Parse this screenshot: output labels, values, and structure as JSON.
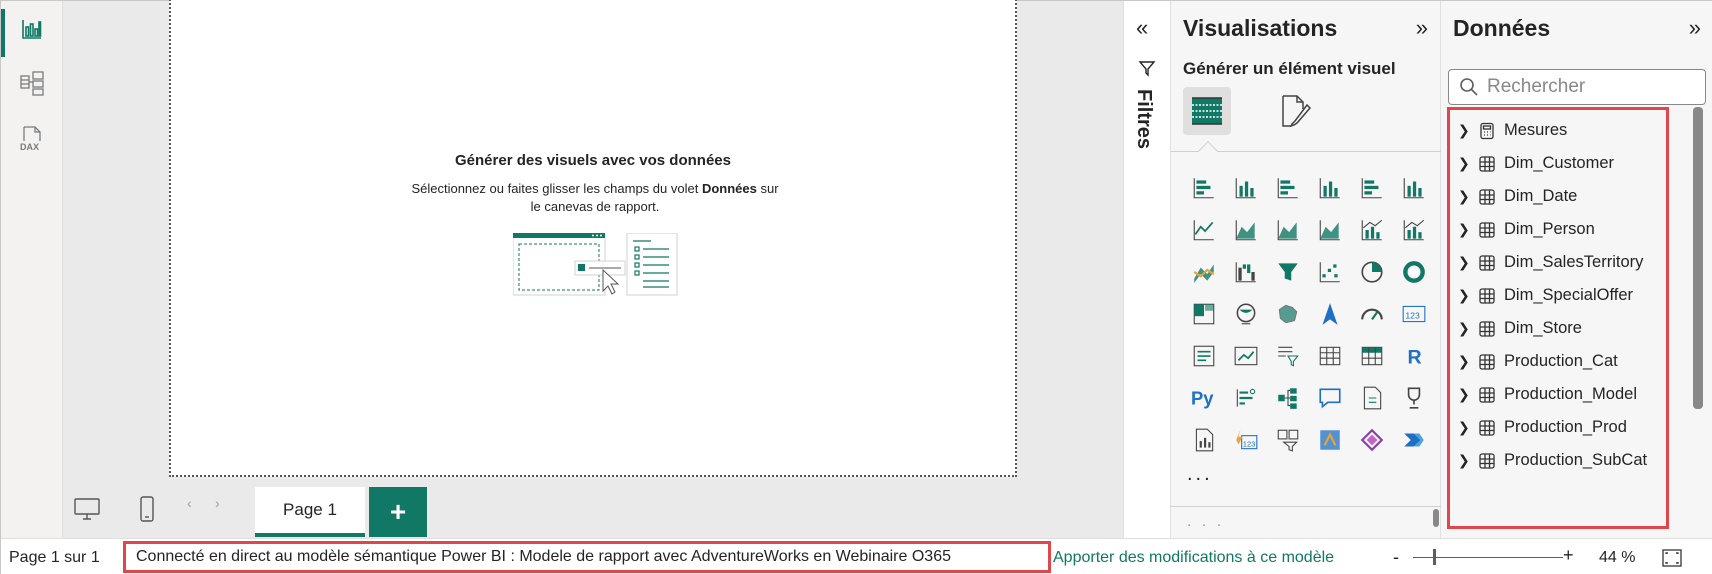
{
  "rail": {
    "items": [
      {
        "icon": "report-view-icon",
        "active": true
      },
      {
        "icon": "model-view-icon",
        "active": false
      },
      {
        "icon": "dax-query-view-icon",
        "active": false,
        "label": "DAX"
      }
    ]
  },
  "canvas": {
    "empty_title": "Générer des visuels avec vos données",
    "empty_desc_pre": "Sélectionnez ou faites glisser les champs du volet ",
    "empty_desc_bold": "Données",
    "empty_desc_post": " sur le canevas de rapport."
  },
  "tabs": {
    "page_label": "Page 1",
    "add_label": "+"
  },
  "filters": {
    "label": "Filtres",
    "collapse_icon": "«"
  },
  "visualisations": {
    "title": "Visualisations",
    "collapse_icon": "»",
    "subtitle": "Générer un élément visuel",
    "more": "...",
    "icons": [
      "stacked-bar-icon",
      "stacked-column-icon",
      "clustered-bar-icon",
      "clustered-column-icon",
      "100-bar-icon",
      "100-column-icon",
      "line-chart-icon",
      "area-chart-icon",
      "stacked-area-icon",
      "100-area-icon",
      "line-column-icon",
      "line-clustered-column-icon",
      "ribbon-chart-icon",
      "waterfall-icon",
      "funnel-icon",
      "scatter-icon",
      "pie-icon",
      "donut-icon",
      "treemap-icon",
      "map-icon",
      "filled-map-icon",
      "azure-map-icon",
      "gauge-icon",
      "card-icon",
      "multi-row-card-icon",
      "kpi-icon",
      "slicer-icon",
      "table-icon",
      "matrix-icon",
      "r-visual-icon",
      "python-visual-icon",
      "key-influencers-icon",
      "decomposition-tree-icon",
      "qa-icon",
      "paginated-report-icon",
      "metrics-icon",
      "narrative-icon",
      "new-card-icon",
      "new-slicer-icon",
      "arcgis-icon",
      "power-apps-icon",
      "power-automate-icon"
    ]
  },
  "data_pane": {
    "title": "Données",
    "collapse_icon": "»",
    "search_placeholder": "Rechercher",
    "tables": [
      {
        "name": "Mesures",
        "icon": "calculator-icon"
      },
      {
        "name": "Dim_Customer",
        "icon": "table-icon"
      },
      {
        "name": "Dim_Date",
        "icon": "table-icon"
      },
      {
        "name": "Dim_Person",
        "icon": "table-icon"
      },
      {
        "name": "Dim_SalesTerritory",
        "icon": "table-icon"
      },
      {
        "name": "Dim_SpecialOffer",
        "icon": "table-icon"
      },
      {
        "name": "Dim_Store",
        "icon": "table-icon"
      },
      {
        "name": "Production_Cat",
        "icon": "table-icon"
      },
      {
        "name": "Production_Model",
        "icon": "table-icon"
      },
      {
        "name": "Production_Prod",
        "icon": "table-icon"
      },
      {
        "name": "Production_SubCat",
        "icon": "table-icon"
      }
    ]
  },
  "status": {
    "page_info": "Page 1 sur 1",
    "connection": "Connecté en direct au modèle sémantique Power BI : Modele de rapport avec AdventureWorks en Webinaire O365",
    "edit_link": "Apporter des modifications à ce modèle",
    "zoom_minus": "-",
    "zoom_plus": "+",
    "zoom_percent": "44 %"
  },
  "colors": {
    "accent": "#117865",
    "highlight_border": "#e0474c"
  }
}
